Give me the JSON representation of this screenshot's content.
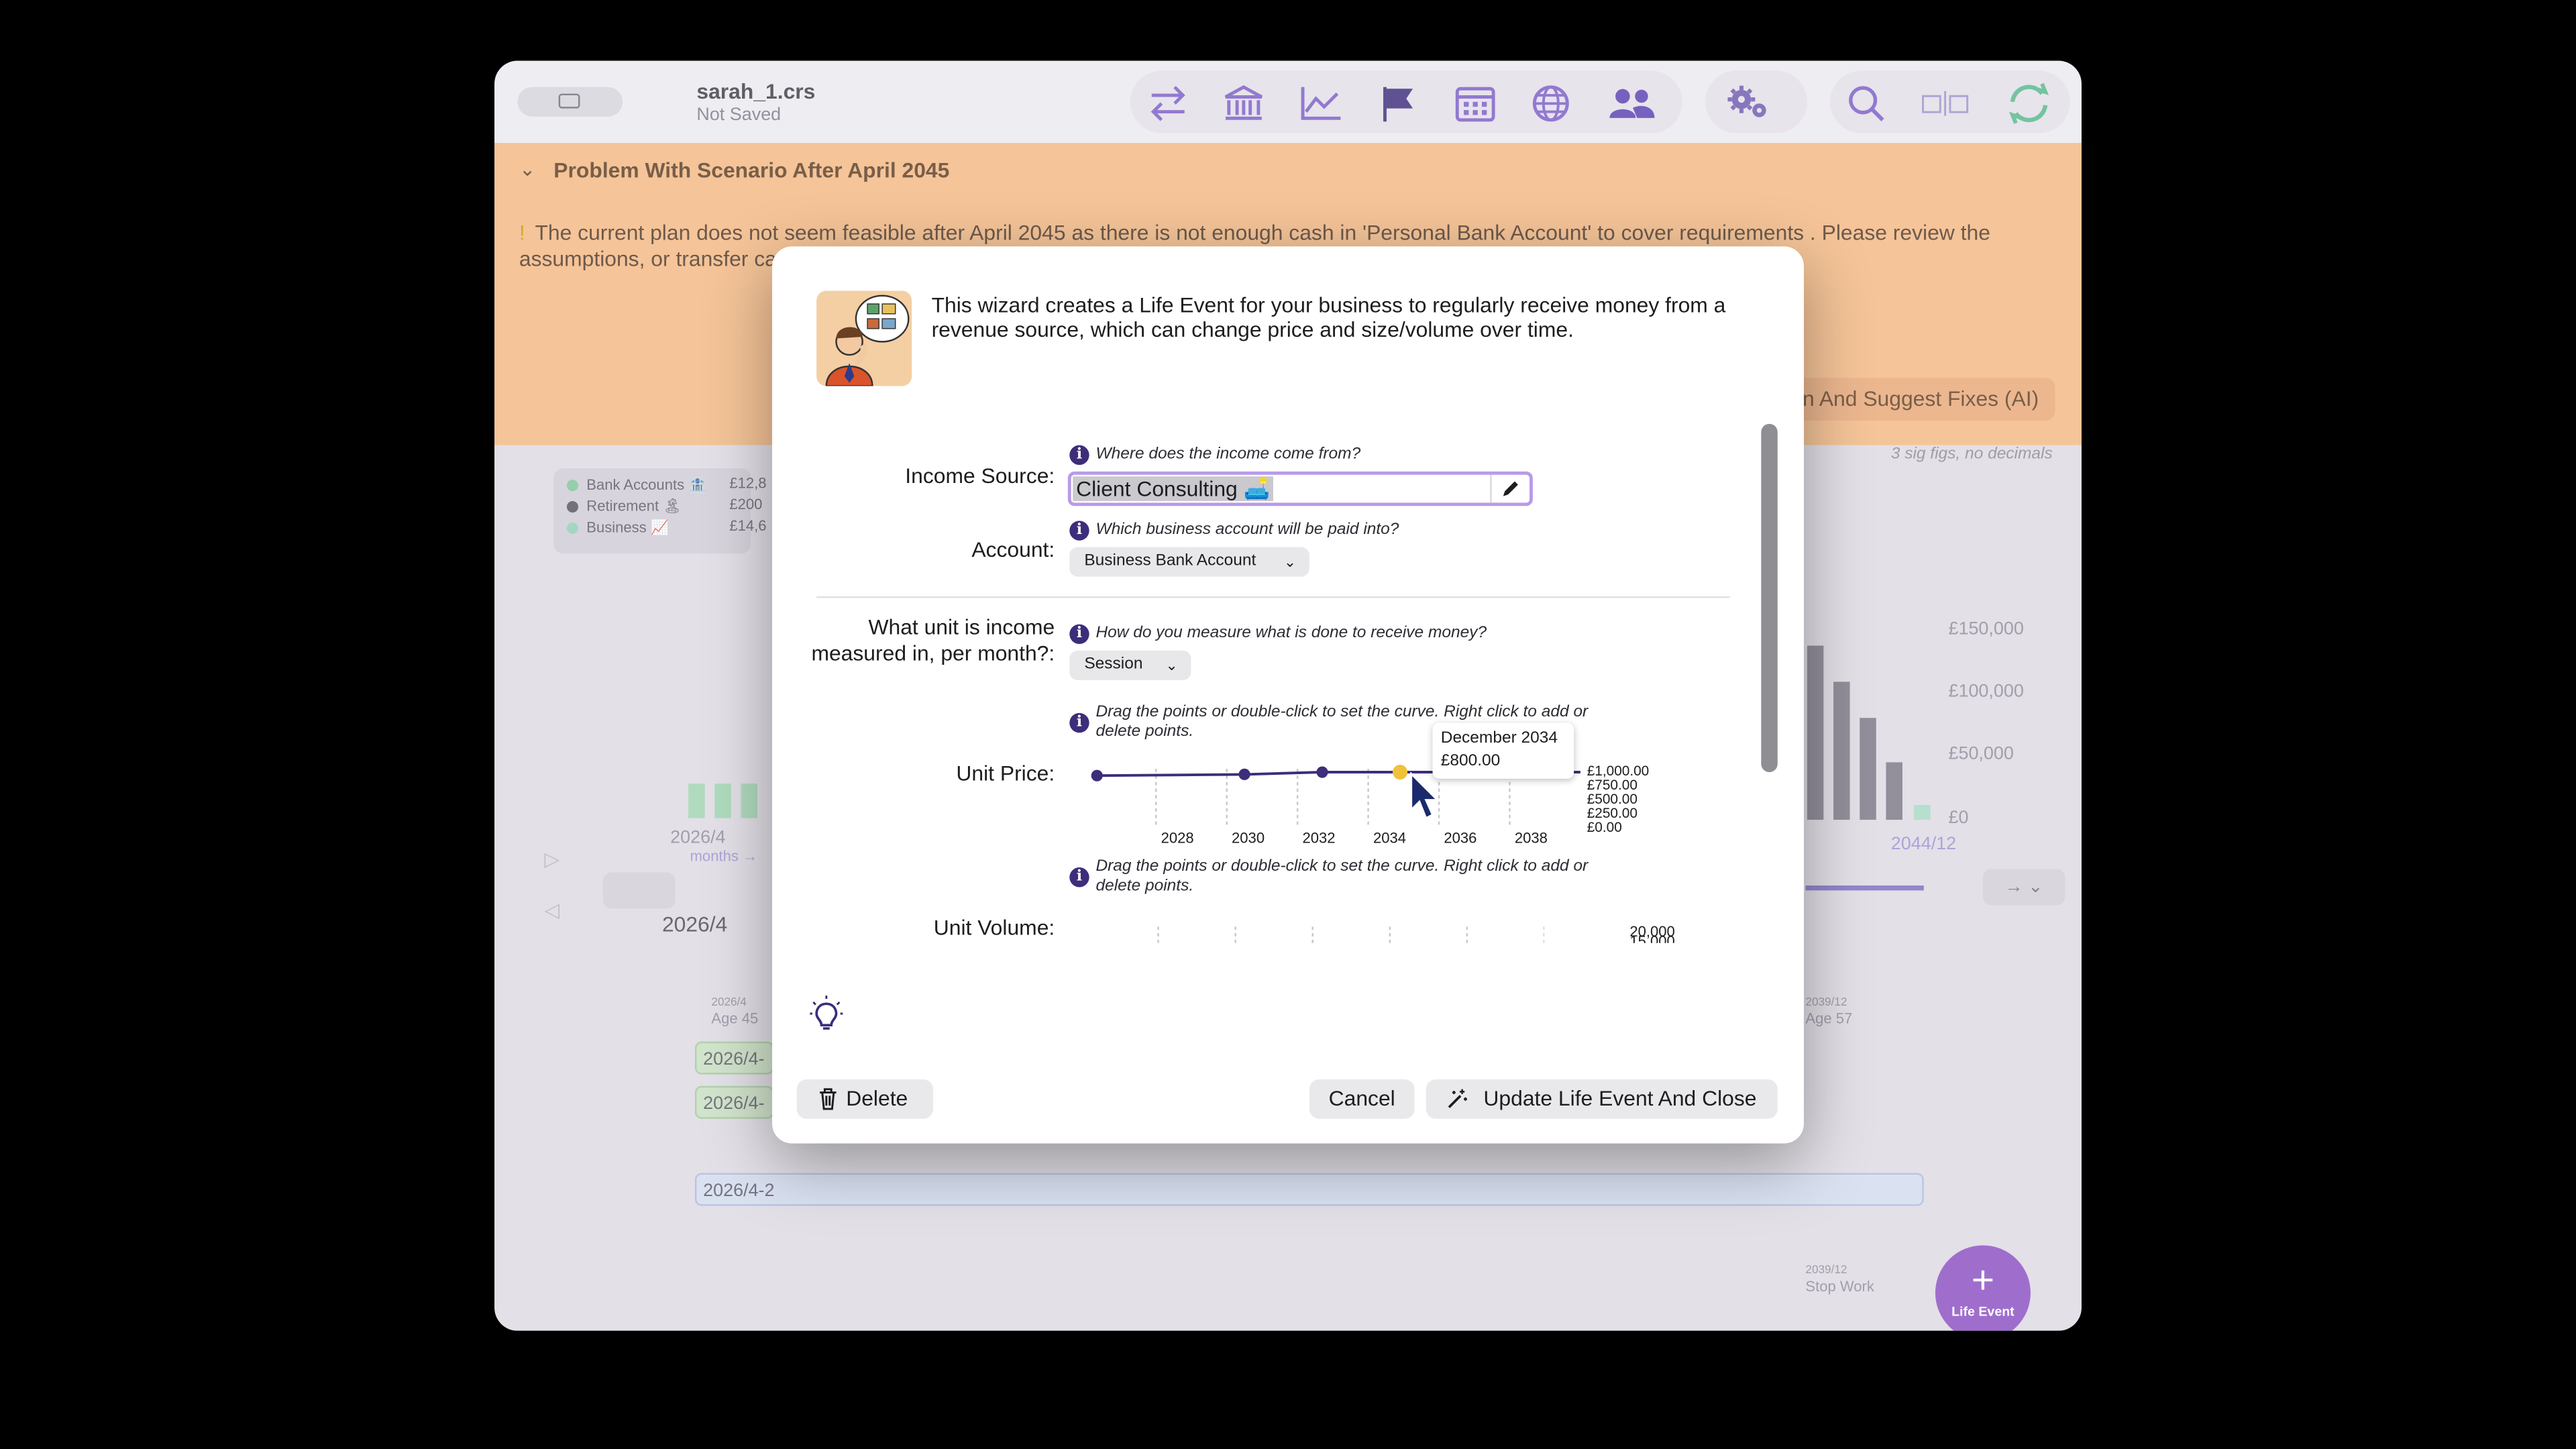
{
  "window": {
    "doc_name": "sarah_1.crs",
    "doc_status": "Not Saved"
  },
  "toolbar": {
    "icons": [
      "transfer-arrows-icon",
      "bank-icon",
      "line-chart-icon",
      "flag-icon",
      "calendar-icon",
      "globe-icon",
      "people-icon",
      "gears-icon",
      "search-icon",
      "split-view-icon",
      "sync-icon"
    ],
    "accent": "#7b5cc6"
  },
  "banner": {
    "title": "Problem With Scenario After April 2045",
    "message": "The current plan does not seem feasible after April 2045 as there is not enough cash in 'Personal Bank Account' to cover requirements . Please review the assumptions, or transfer ca",
    "suggest_button": "n And Suggest Fixes (AI)",
    "color": "#f3b882"
  },
  "background": {
    "sig_figs_note": "3 sig figs, no decimals",
    "legend": [
      {
        "label": "Bank Accounts 🏦",
        "value": "£12,8",
        "color": "#7fc49a"
      },
      {
        "label": "Retirement 🏝",
        "value": "£200",
        "color": "#55515e"
      },
      {
        "label": "Business 📈",
        "value": "£14,6",
        "color": "#8fcfb8"
      }
    ],
    "y_ticks": [
      "£150,000",
      "£100,000",
      "£50,000",
      "£0"
    ],
    "left_date": "2026/4",
    "left_months": "months →",
    "right_date": "2044/12",
    "timeline_date": "2026/4",
    "milestone_start": {
      "date": "2026/4",
      "age": "Age 45"
    },
    "milestone_mid": {
      "date": "2039/12",
      "age": "Age 57"
    },
    "milestone_end": {
      "date": "2039/12",
      "label": "Stop Work"
    },
    "event_pills": [
      "2026/4-",
      "2026/4-",
      "2026/4-2"
    ],
    "fab_label": "Life Event"
  },
  "dialog": {
    "intro": "This wizard creates a Life Event for your business to regularly receive money from a revenue source, which can change price and size/volume over time.",
    "income_source": {
      "label": "Income Source:",
      "hint": "Where does the income come from?",
      "value": "Client Consulting 🛋️"
    },
    "account": {
      "label": "Account:",
      "hint": "Which business account will be paid into?",
      "value": "Business Bank Account"
    },
    "unit": {
      "label": "What unit is income measured in, per month?:",
      "hint": "How do you measure what is done to receive money?",
      "value": "Session"
    },
    "unit_price": {
      "label": "Unit Price:",
      "hint": "Drag the points or double-click to set the curve. Right click to add or delete points.",
      "tooltip_date": "December 2034",
      "tooltip_value": "£800.00"
    },
    "unit_volume": {
      "label": "Unit Volume:",
      "hint": "Drag the points or double-click to set the curve. Right click to add or delete points.",
      "y_top": "20,000",
      "y_next": "15,000"
    },
    "buttons": {
      "delete": "Delete",
      "cancel": "Cancel",
      "update": "Update Life Event And Close"
    }
  },
  "chart_data": {
    "type": "line",
    "title": "",
    "xlabel": "",
    "ylabel": "",
    "x_ticks": [
      "2028",
      "2030",
      "2032",
      "2034",
      "2036",
      "2038"
    ],
    "y_ticks": [
      "£1,000.00",
      "£750.00",
      "£500.00",
      "£250.00",
      "£0.00"
    ],
    "ylim": [
      0,
      1000
    ],
    "xlim": [
      2026.25,
      2040
    ],
    "grid": true,
    "series": [
      {
        "x": [
          2026.33,
          2030.5,
          2032.7,
          2034.9,
          2040
        ],
        "y": [
          730,
          755,
          800,
          800,
          800
        ]
      }
    ],
    "highlight_point": {
      "x": 2034.9,
      "y": 800
    },
    "line_color": "#3d2d7a"
  }
}
